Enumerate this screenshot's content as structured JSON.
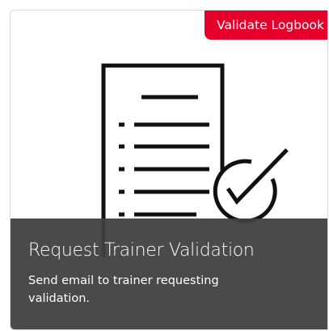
{
  "card": {
    "badge_label": "Validate Logbook",
    "title": "Request Trainer Validation",
    "description": "Send email to trainer requesting validation.",
    "icon": "document-checklist-check-icon"
  },
  "colors": {
    "badge_bg": "#e4002b",
    "overlay_bg": "#404040",
    "icon_stroke": "#111111"
  }
}
